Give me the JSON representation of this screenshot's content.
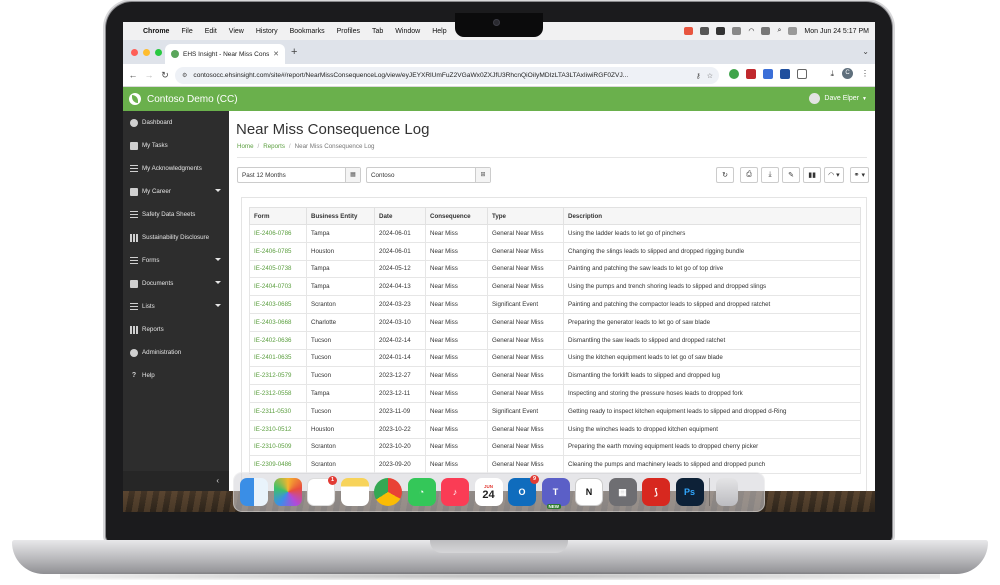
{
  "menubar": {
    "app": "Chrome",
    "items": [
      "File",
      "Edit",
      "View",
      "History",
      "Bookmarks",
      "Profiles",
      "Tab",
      "Window",
      "Help"
    ],
    "clock": "Mon Jun 24  5:17 PM"
  },
  "browser": {
    "tab_title": "EHS Insight - Near Miss Conse",
    "url": "contosocc.ehsinsight.com/site#/report/NearMissConsequenceLog/view/eyJEYXRlUmFuZ2VGaWx0ZXJfU3RhcnQiOiIyMDIzLTA3LTAxIiwiRGF0ZVJ..."
  },
  "header": {
    "brand": "Contoso Demo (CC)",
    "user": "Dave Elper"
  },
  "sidebar": {
    "items": [
      {
        "label": "Dashboard",
        "icon": "dashboard-icon"
      },
      {
        "label": "My Tasks",
        "icon": "tasks-icon"
      },
      {
        "label": "My Acknowledgments",
        "icon": "acknowledgments-icon"
      },
      {
        "label": "My Career",
        "icon": "career-icon"
      },
      {
        "label": "Safety Data Sheets",
        "icon": "sds-icon"
      },
      {
        "label": "Sustainability Disclosure",
        "icon": "sustainability-icon"
      },
      {
        "label": "Forms",
        "icon": "forms-icon"
      },
      {
        "label": "Documents",
        "icon": "documents-icon"
      },
      {
        "label": "Lists",
        "icon": "lists-icon"
      },
      {
        "label": "Reports",
        "icon": "reports-icon"
      },
      {
        "label": "Administration",
        "icon": "administration-icon"
      },
      {
        "label": "Help",
        "icon": "help-icon"
      }
    ]
  },
  "page": {
    "title": "Near Miss Consequence Log",
    "breadcrumb": [
      "Home",
      "Reports",
      "Near Miss Consequence Log"
    ],
    "date_filter": "Past 12 Months",
    "entity_filter": "Contoso"
  },
  "table": {
    "columns": [
      "Form",
      "Business Entity",
      "Date",
      "Consequence",
      "Type",
      "Description"
    ],
    "rows": [
      [
        "IE-2406-0786",
        "Tampa",
        "2024-06-01",
        "Near Miss",
        "General Near Miss",
        "Using the ladder leads to let go of pinchers"
      ],
      [
        "IE-2406-0785",
        "Houston",
        "2024-06-01",
        "Near Miss",
        "General Near Miss",
        "Changing the slings leads to slipped and dropped rigging bundle"
      ],
      [
        "IE-2405-0738",
        "Tampa",
        "2024-05-12",
        "Near Miss",
        "General Near Miss",
        "Painting and patching the saw leads to let go of top drive"
      ],
      [
        "IE-2404-0703",
        "Tampa",
        "2024-04-13",
        "Near Miss",
        "General Near Miss",
        "Using the pumps and trench shoring leads to slipped and dropped slings"
      ],
      [
        "IE-2403-0685",
        "Scranton",
        "2024-03-23",
        "Near Miss",
        "Significant Event",
        "Painting and patching the compactor leads to slipped and dropped ratchet"
      ],
      [
        "IE-2403-0668",
        "Charlotte",
        "2024-03-10",
        "Near Miss",
        "General Near Miss",
        "Preparing the generator leads to let go of saw blade"
      ],
      [
        "IE-2402-0636",
        "Tucson",
        "2024-02-14",
        "Near Miss",
        "General Near Miss",
        "Dismantling the saw leads to slipped and dropped ratchet"
      ],
      [
        "IE-2401-0635",
        "Tucson",
        "2024-01-14",
        "Near Miss",
        "General Near Miss",
        "Using the kitchen equipment leads to let go of saw blade"
      ],
      [
        "IE-2312-0579",
        "Tucson",
        "2023-12-27",
        "Near Miss",
        "General Near Miss",
        "Dismantling the forklift leads to slipped and dropped lug"
      ],
      [
        "IE-2312-0558",
        "Tampa",
        "2023-12-11",
        "Near Miss",
        "General Near Miss",
        "Inspecting and storing the pressure hoses leads to dropped fork"
      ],
      [
        "IE-2311-0530",
        "Tucson",
        "2023-11-09",
        "Near Miss",
        "Significant Event",
        "Getting ready to inspect kitchen equipment leads to slipped and dropped d-Ring"
      ],
      [
        "IE-2310-0512",
        "Houston",
        "2023-10-22",
        "Near Miss",
        "General Near Miss",
        "Using the winches leads to dropped kitchen equipment"
      ],
      [
        "IE-2310-0509",
        "Scranton",
        "2023-10-20",
        "Near Miss",
        "General Near Miss",
        "Preparing the earth moving equipment leads to dropped cherry picker"
      ],
      [
        "IE-2309-0486",
        "Scranton",
        "2023-09-20",
        "Near Miss",
        "General Near Miss",
        "Cleaning the pumps and machinery leads to slipped and dropped punch"
      ]
    ]
  },
  "dock": {
    "reminders_badge": "1",
    "calendar_month": "JUN",
    "calendar_day": "24",
    "outlook_badge": "9",
    "teams_label": "NEW",
    "apps": [
      "finder-icon",
      "photos-icon",
      "reminders-icon",
      "notes-icon",
      "chrome-icon",
      "messages-icon",
      "music-icon",
      "calendar-icon",
      "outlook-icon",
      "teams-icon",
      "notion-icon",
      "calculator-icon",
      "acrobat-icon",
      "photoshop-icon",
      "trash-icon"
    ]
  },
  "colors": {
    "brand_green": "#6ab04c",
    "link_green": "#5a9e3e",
    "sidebar_bg": "#2d2d2d"
  }
}
